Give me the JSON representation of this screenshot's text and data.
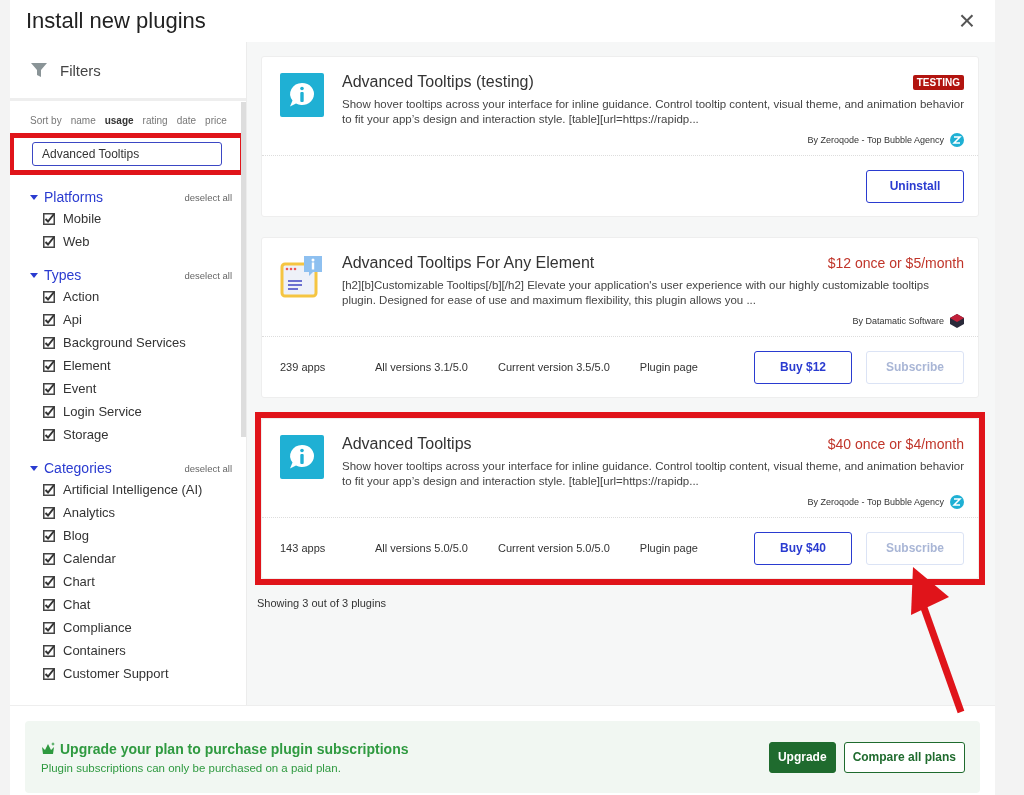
{
  "dialog": {
    "title": "Install new plugins",
    "close": "×"
  },
  "filters": {
    "title": "Filters",
    "sort_label": "Sort by",
    "sort_options": [
      {
        "label": "name",
        "selected": false
      },
      {
        "label": "usage",
        "selected": true
      },
      {
        "label": "rating",
        "selected": false
      },
      {
        "label": "date",
        "selected": false
      },
      {
        "label": "price",
        "selected": false
      }
    ],
    "search": {
      "value": "Advanced Tooltips",
      "highlighted": true
    },
    "groups": [
      {
        "title": "Platforms",
        "expanded": true,
        "action": "deselect all",
        "items": [
          {
            "label": "Mobile",
            "checked": true
          },
          {
            "label": "Web",
            "checked": true
          }
        ]
      },
      {
        "title": "Types",
        "expanded": true,
        "action": "deselect all",
        "items": [
          {
            "label": "Action",
            "checked": true
          },
          {
            "label": "Api",
            "checked": true
          },
          {
            "label": "Background Services",
            "checked": true
          },
          {
            "label": "Element",
            "checked": true
          },
          {
            "label": "Event",
            "checked": true
          },
          {
            "label": "Login Service",
            "checked": true
          },
          {
            "label": "Storage",
            "checked": true
          }
        ]
      },
      {
        "title": "Categories",
        "expanded": true,
        "action": "deselect all",
        "items": [
          {
            "label": "Artificial Intelligence (AI)",
            "checked": true
          },
          {
            "label": "Analytics",
            "checked": true
          },
          {
            "label": "Blog",
            "checked": true
          },
          {
            "label": "Calendar",
            "checked": true
          },
          {
            "label": "Chart",
            "checked": true
          },
          {
            "label": "Chat",
            "checked": true
          },
          {
            "label": "Compliance",
            "checked": true
          },
          {
            "label": "Containers",
            "checked": true
          },
          {
            "label": "Customer Support",
            "checked": true
          }
        ]
      }
    ]
  },
  "plugins": [
    {
      "kind": "bubble",
      "name": "Advanced Tooltips (testing)",
      "badge": "TESTING",
      "description": "Show hover tooltips across your interface for inline guidance. Control tooltip content, visual theme, and animation behavior to fit your app’s design and interaction style. [table][url=https://rapidp...",
      "author": "By Zeroqode - Top Bubble Agency",
      "highlighted": false,
      "arrow": false,
      "buttons": [
        {
          "label": "Uninstall",
          "disabled": false
        }
      ]
    },
    {
      "kind": "window",
      "name": "Advanced Tooltips For Any Element",
      "price": "$12 once or $5/month",
      "description": "[h2][b]Customizable Tooltips[/b][/h2] Elevate your application's user experience with our highly customizable tooltips plugin. Designed for ease of use and maximum flexibility, this plugin allows you ...",
      "author": "By Datamatic Software",
      "highlighted": false,
      "arrow": false,
      "stats": [
        "239 apps",
        "All versions 3.1/5.0",
        "Current version 3.5/5.0"
      ],
      "page_link": "Plugin page",
      "buttons": [
        {
          "label": "Buy $12",
          "disabled": false
        },
        {
          "label": "Subscribe",
          "disabled": true
        }
      ]
    },
    {
      "kind": "bubble",
      "name": "Advanced Tooltips",
      "price": "$40 once or $4/month",
      "description": "Show hover tooltips across your interface for inline guidance. Control tooltip content, visual theme, and animation behavior to fit your app’s design and interaction style. [table][url=https://rapidp...",
      "author": "By Zeroqode - Top Bubble Agency",
      "highlighted": true,
      "arrow": true,
      "stats": [
        "143 apps",
        "All versions 5.0/5.0",
        "Current version 5.0/5.0"
      ],
      "page_link": "Plugin page",
      "buttons": [
        {
          "label": "Buy $40",
          "disabled": false
        },
        {
          "label": "Subscribe",
          "disabled": true
        }
      ]
    }
  ],
  "results_count": "Showing 3 out of 3 plugins",
  "upgrade_banner": {
    "title": "Upgrade your plan to purchase plugin subscriptions",
    "subtitle": "Plugin subscriptions can only be purchased on a paid plan.",
    "buttons": [
      {
        "label": "Upgrade",
        "primary": true
      },
      {
        "label": "Compare all plans",
        "primary": false
      }
    ]
  }
}
